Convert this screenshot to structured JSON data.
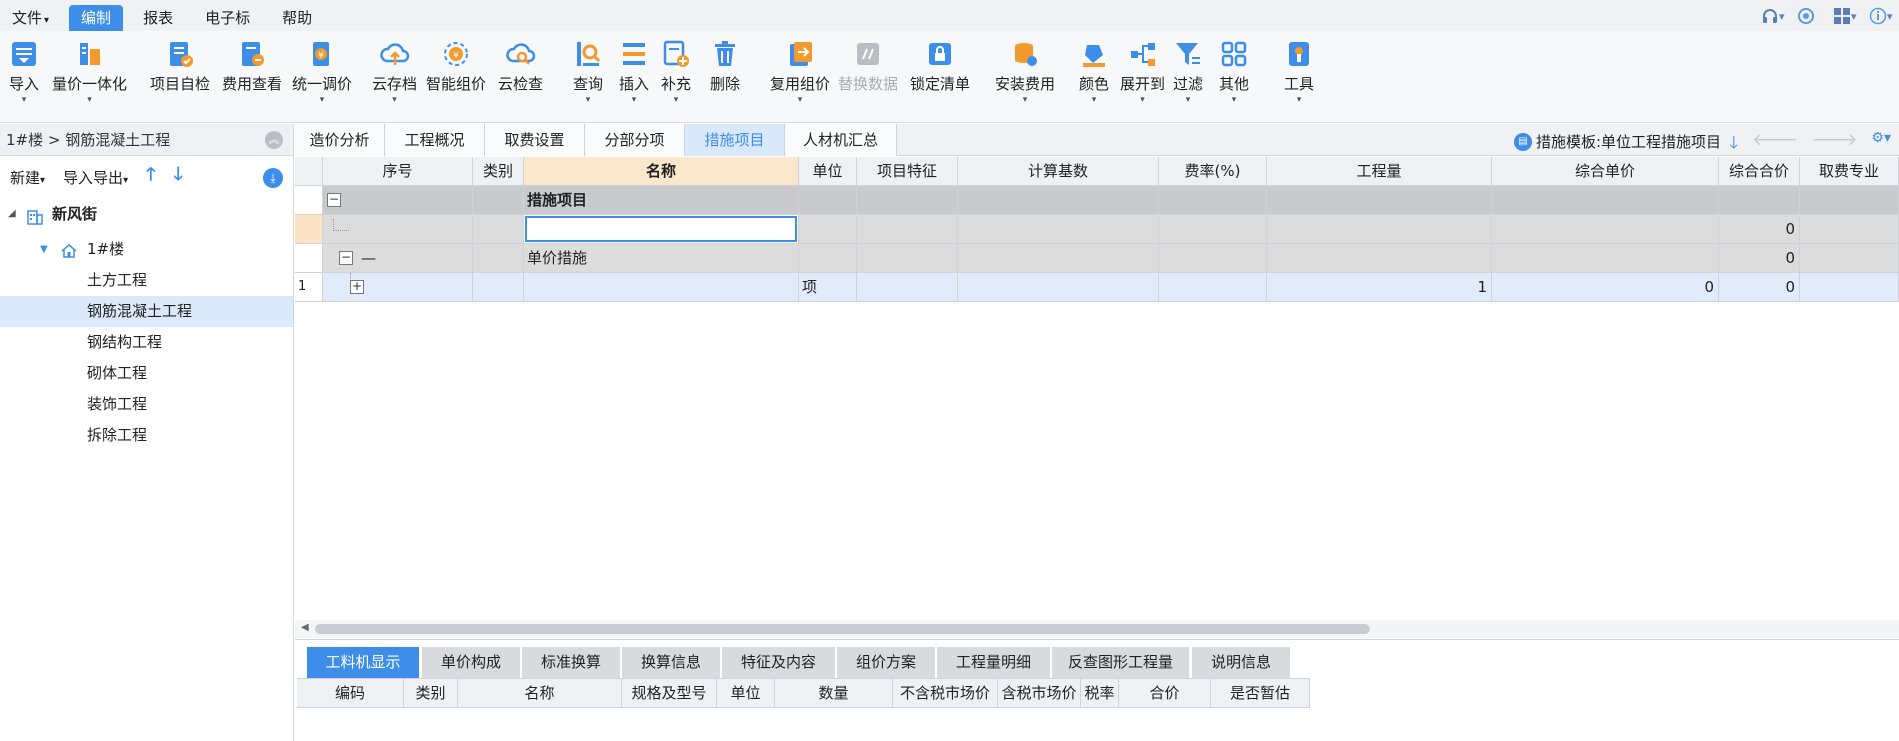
{
  "menu": {
    "items": [
      {
        "label": "文件",
        "caret": "▾"
      },
      {
        "label": "编制",
        "caret": ""
      },
      {
        "label": "报表",
        "caret": ""
      },
      {
        "label": "电子标",
        "caret": ""
      },
      {
        "label": "帮助",
        "caret": ""
      }
    ],
    "active_index": 1
  },
  "ribbon": {
    "buttons": [
      {
        "label": "导入",
        "icon": "import-icon"
      },
      {
        "label": "量价一体化",
        "icon": "price-integration-icon"
      },
      {
        "label": "项目自检",
        "icon": "self-check-icon"
      },
      {
        "label": "费用查看",
        "icon": "fee-view-icon"
      },
      {
        "label": "统一调价",
        "icon": "unified-price-icon"
      },
      {
        "label": "云存档",
        "icon": "cloud-upload-icon"
      },
      {
        "label": "智能组价",
        "icon": "smart-pricing-icon"
      },
      {
        "label": "云检查",
        "icon": "cloud-check-icon"
      },
      {
        "label": "查询",
        "icon": "query-icon"
      },
      {
        "label": "插入",
        "icon": "insert-icon"
      },
      {
        "label": "补充",
        "icon": "supplement-icon"
      },
      {
        "label": "删除",
        "icon": "delete-icon"
      },
      {
        "label": "复用组价",
        "icon": "reuse-pricing-icon"
      },
      {
        "label": "替换数据",
        "icon": "replace-data-icon"
      },
      {
        "label": "锁定清单",
        "icon": "lock-icon"
      },
      {
        "label": "安装费用",
        "icon": "install-fee-icon"
      },
      {
        "label": "颜色",
        "icon": "color-icon"
      },
      {
        "label": "展开到",
        "icon": "expand-icon"
      },
      {
        "label": "过滤",
        "icon": "filter-icon"
      },
      {
        "label": "其他",
        "icon": "other-icon"
      },
      {
        "label": "工具",
        "icon": "tools-icon"
      }
    ],
    "dropdown_mark": "▾"
  },
  "left": {
    "breadcrumb": "1#楼 > 钢筋混凝土工程",
    "new_label": "新建",
    "import_export_label": "导入导出",
    "tree": {
      "root": "新风街",
      "building": "1#楼",
      "items": [
        "土方工程",
        "钢筋混凝土工程",
        "钢结构工程",
        "砌体工程",
        "装饰工程",
        "拆除工程"
      ]
    }
  },
  "tabs": {
    "items": [
      "造价分析",
      "工程概况",
      "取费设置",
      "分部分项",
      "措施项目",
      "人材机汇总"
    ],
    "active_index": 4
  },
  "template": {
    "label": "措施模板:单位工程措施项目"
  },
  "grid": {
    "columns": [
      "序号",
      "类别",
      "名称",
      "单位",
      "项目特征",
      "计算基数",
      "费率(%)",
      "工程量",
      "综合单价",
      "综合合价",
      "取费专业"
    ],
    "rows": [
      {
        "seq": "",
        "type": "",
        "name": "措施项目",
        "unit": "",
        "qty": "",
        "price": "",
        "total": ""
      },
      {
        "seq": "",
        "type": "",
        "name": "",
        "unit": "",
        "qty": "",
        "price": "",
        "total": "0"
      },
      {
        "seq": "—",
        "type": "",
        "name": "单价措施",
        "unit": "",
        "qty": "",
        "price": "",
        "total": "0"
      },
      {
        "seq": "1",
        "type": "",
        "name": "",
        "unit": "项",
        "qty": "1",
        "price": "0",
        "total": "0"
      }
    ]
  },
  "bottom": {
    "tabs": [
      "工料机显示",
      "单价构成",
      "标准换算",
      "换算信息",
      "特征及内容",
      "组价方案",
      "工程量明细",
      "反查图形工程量",
      "说明信息"
    ],
    "active_index": 0,
    "columns": [
      "编码",
      "类别",
      "名称",
      "规格及型号",
      "单位",
      "数量",
      "不含税市场价",
      "含税市场价",
      "税率",
      "合价",
      "是否暂估"
    ]
  }
}
